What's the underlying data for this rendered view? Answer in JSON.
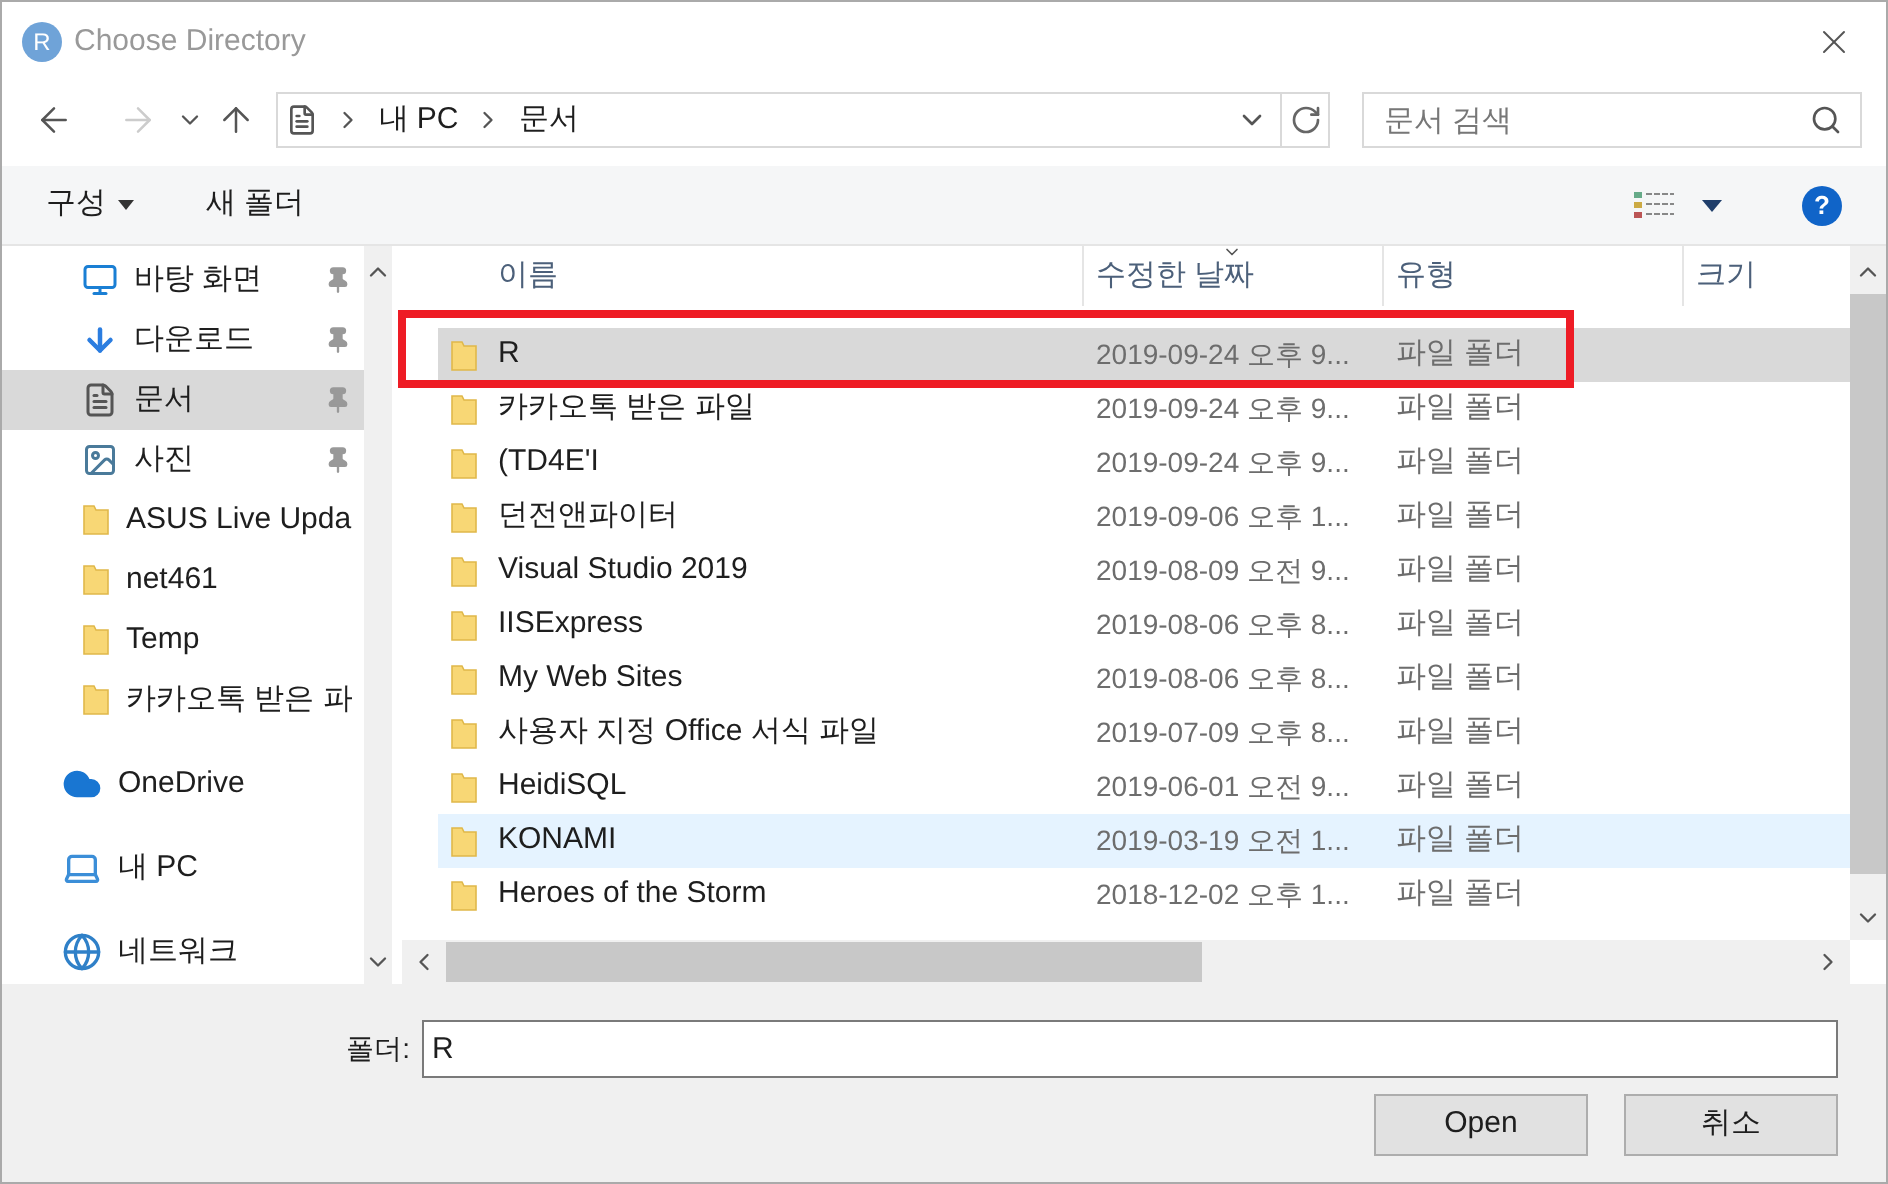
{
  "window": {
    "title": "Choose Directory",
    "app_icon": "R"
  },
  "breadcrumb": [
    "내 PC",
    "문서"
  ],
  "search": {
    "placeholder": "문서 검색"
  },
  "toolbar": {
    "organize": "구성",
    "new_folder": "새 폴더",
    "help": "?"
  },
  "sidebar": {
    "items": [
      {
        "label": "바탕 화면",
        "kind": "desktop",
        "pinned": true,
        "selected": false
      },
      {
        "label": "다운로드",
        "kind": "download",
        "pinned": true,
        "selected": false
      },
      {
        "label": "문서",
        "kind": "document",
        "pinned": true,
        "selected": true
      },
      {
        "label": "사진",
        "kind": "picture",
        "pinned": true,
        "selected": false
      },
      {
        "label": "ASUS Live Upda",
        "kind": "folder",
        "pinned": false,
        "selected": false
      },
      {
        "label": "net461",
        "kind": "folder",
        "pinned": false,
        "selected": false
      },
      {
        "label": "Temp",
        "kind": "folder",
        "pinned": false,
        "selected": false
      },
      {
        "label": "카카오톡 받은 파",
        "kind": "folder",
        "pinned": false,
        "selected": false
      },
      {
        "label": "OneDrive",
        "kind": "cloud",
        "pinned": false,
        "selected": false
      },
      {
        "label": "내 PC",
        "kind": "pc",
        "pinned": false,
        "selected": false
      },
      {
        "label": "네트워크",
        "kind": "network",
        "pinned": false,
        "selected": false
      }
    ]
  },
  "table": {
    "columns": [
      "이름",
      "수정한 날짜",
      "유형",
      "크기"
    ],
    "rows": [
      {
        "name": "R",
        "modified": "2019-09-24 오후 9...",
        "type": "파일 폴더",
        "selected": true,
        "hovered": false
      },
      {
        "name": "카카오톡 받은 파일",
        "modified": "2019-09-24 오후 9...",
        "type": "파일 폴더",
        "selected": false,
        "hovered": false
      },
      {
        "name": "(TD4E'I",
        "modified": "2019-09-24 오후 9...",
        "type": "파일 폴더",
        "selected": false,
        "hovered": false
      },
      {
        "name": "던전앤파이터",
        "modified": "2019-09-06 오후 1...",
        "type": "파일 폴더",
        "selected": false,
        "hovered": false
      },
      {
        "name": "Visual Studio 2019",
        "modified": "2019-08-09 오전 9...",
        "type": "파일 폴더",
        "selected": false,
        "hovered": false
      },
      {
        "name": "IISExpress",
        "modified": "2019-08-06 오후 8...",
        "type": "파일 폴더",
        "selected": false,
        "hovered": false
      },
      {
        "name": "My Web Sites",
        "modified": "2019-08-06 오후 8...",
        "type": "파일 폴더",
        "selected": false,
        "hovered": false
      },
      {
        "name": "사용자 지정 Office 서식 파일",
        "modified": "2019-07-09 오후 8...",
        "type": "파일 폴더",
        "selected": false,
        "hovered": false
      },
      {
        "name": "HeidiSQL",
        "modified": "2019-06-01 오전 9...",
        "type": "파일 폴더",
        "selected": false,
        "hovered": false
      },
      {
        "name": "KONAMI",
        "modified": "2019-03-19 오전 1...",
        "type": "파일 폴더",
        "selected": false,
        "hovered": true
      },
      {
        "name": "Heroes of the Storm",
        "modified": "2018-12-02 오후 1...",
        "type": "파일 폴더",
        "selected": false,
        "hovered": false
      }
    ]
  },
  "footer": {
    "label": "폴더:",
    "value": "R",
    "buttons": [
      "Open",
      "취소"
    ]
  }
}
